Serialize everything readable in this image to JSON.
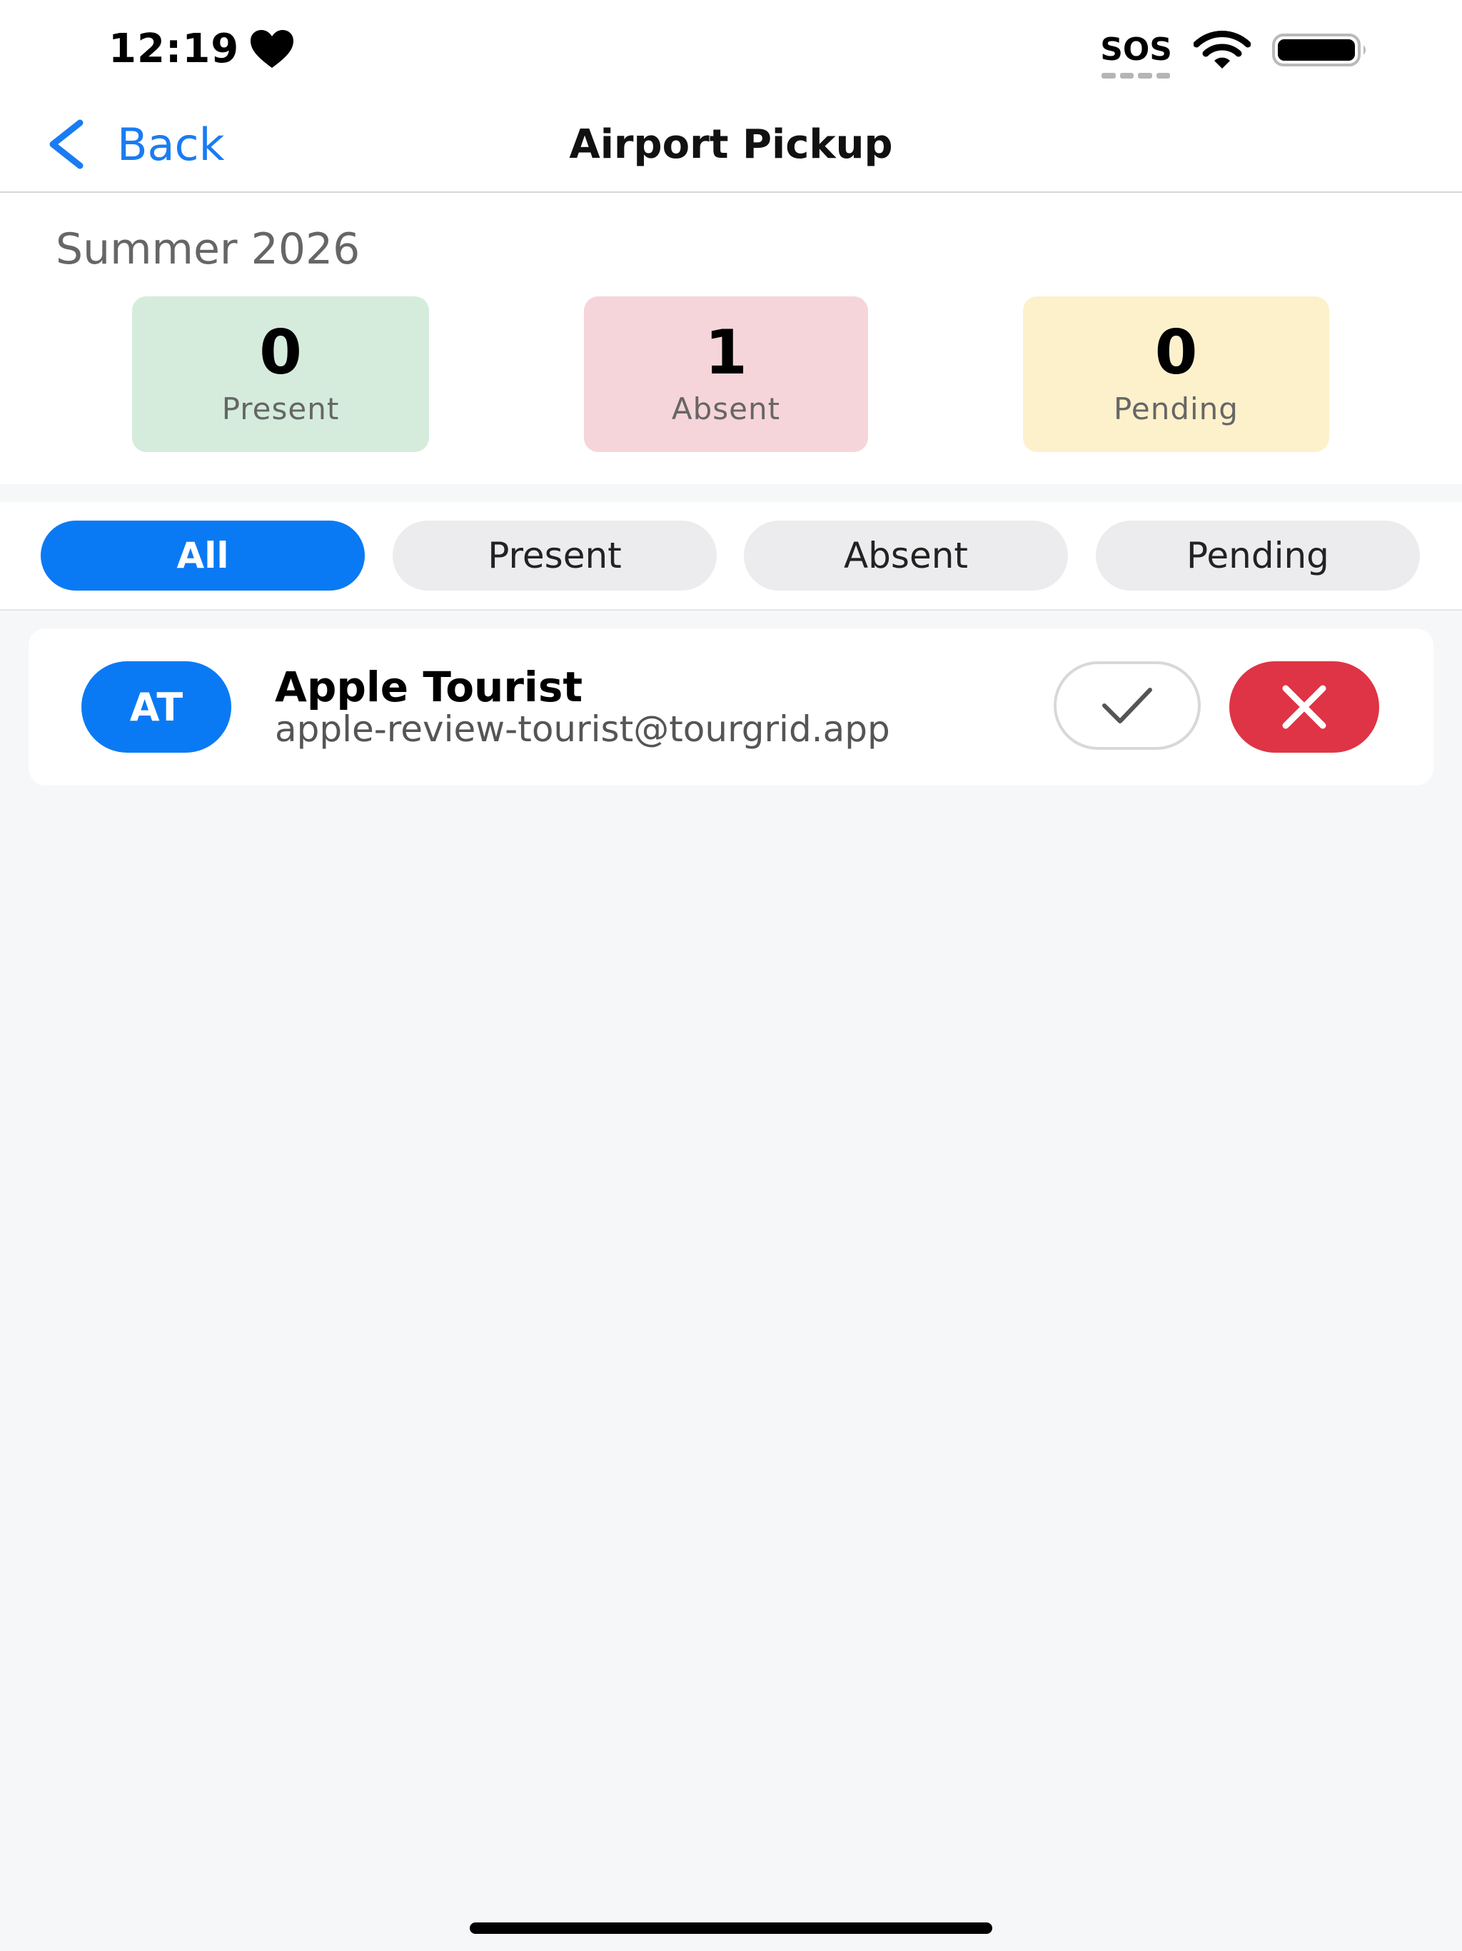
{
  "status_bar": {
    "time": "12:19",
    "carrier": "SOS"
  },
  "nav": {
    "back_label": "Back",
    "title": "Airport Pickup"
  },
  "summary": {
    "season": "Summer 2026",
    "stats": [
      {
        "value": "0",
        "label": "Present",
        "bg": "#d5ecdc"
      },
      {
        "value": "1",
        "label": "Absent",
        "bg": "#f6d5da"
      },
      {
        "value": "0",
        "label": "Pending",
        "bg": "#fdf1cc"
      }
    ]
  },
  "filters": [
    {
      "label": "All",
      "active": true
    },
    {
      "label": "Present",
      "active": false
    },
    {
      "label": "Absent",
      "active": false
    },
    {
      "label": "Pending",
      "active": false
    }
  ],
  "attendees": [
    {
      "initials": "AT",
      "name": "Apple Tourist",
      "email": "apple-review-tourist@tourgrid.app"
    }
  ],
  "colors": {
    "accent": "#0a7af4",
    "danger": "#df3445"
  }
}
